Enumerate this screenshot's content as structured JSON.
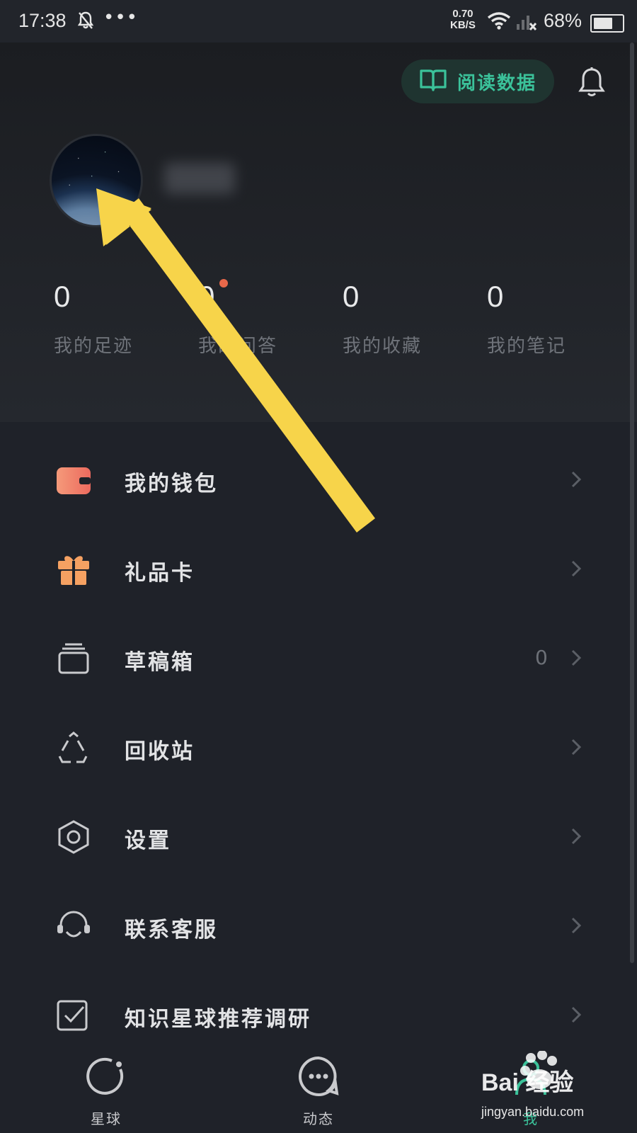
{
  "status_bar": {
    "time": "17:38",
    "more": "•••",
    "speed_value": "0.70",
    "speed_unit": "KB/S",
    "battery": "68%",
    "battery_level": 0.68
  },
  "header": {
    "reading_data_label": "阅读数据",
    "notification_icon": "bell-icon"
  },
  "stats": [
    {
      "value": "0",
      "label": "我的足迹"
    },
    {
      "value": "0",
      "label": "我的问答"
    },
    {
      "value": "0",
      "label": "我的收藏"
    },
    {
      "value": "0",
      "label": "我的笔记"
    }
  ],
  "menu": [
    {
      "label": "我的钱包",
      "icon": "wallet-icon"
    },
    {
      "label": "礼品卡",
      "icon": "gift-icon"
    },
    {
      "label": "草稿箱",
      "icon": "drafts-icon",
      "count": "0"
    },
    {
      "label": "回收站",
      "icon": "recycle-icon"
    },
    {
      "label": "设置",
      "icon": "settings-icon"
    },
    {
      "label": "联系客服",
      "icon": "customer-service-icon"
    },
    {
      "label": "知识星球推荐调研",
      "icon": "survey-icon"
    }
  ],
  "tabs": [
    {
      "label": "星球",
      "icon": "planet-icon"
    },
    {
      "label": "动态",
      "icon": "chat-icon"
    },
    {
      "label": "我",
      "icon": "profile-icon",
      "active": true
    }
  ],
  "colors": {
    "accent": "#3bc29a",
    "background": "#1f2229",
    "wallet": "#ef7a6a",
    "gift": "#f5a162",
    "annotation_arrow": "#f7d44a"
  },
  "watermark": {
    "brand": "Bai 经验",
    "url": "jingyan.baidu.com"
  }
}
